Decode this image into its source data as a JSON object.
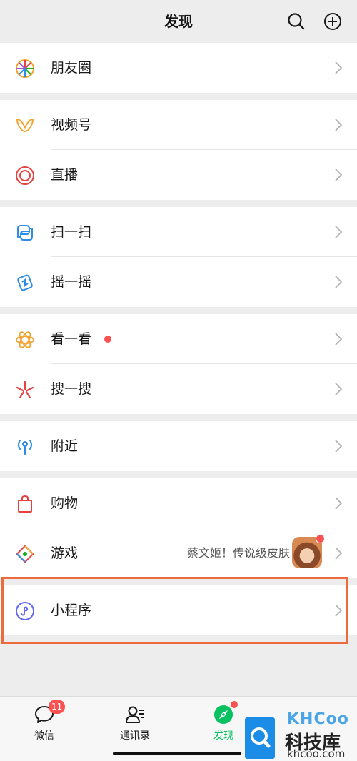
{
  "header": {
    "title": "发现"
  },
  "groups": [
    {
      "items": [
        {
          "label": "朋友圈"
        }
      ]
    },
    {
      "items": [
        {
          "label": "视频号"
        },
        {
          "label": "直播"
        }
      ]
    },
    {
      "items": [
        {
          "label": "扫一扫"
        },
        {
          "label": "摇一摇"
        }
      ]
    },
    {
      "items": [
        {
          "label": "看一看"
        },
        {
          "label": "搜一搜"
        }
      ]
    },
    {
      "items": [
        {
          "label": "附近"
        }
      ]
    },
    {
      "items": [
        {
          "label": "购物"
        },
        {
          "label": "游戏",
          "subtitle": "蔡文姬！传说级皮肤"
        }
      ]
    },
    {
      "items": [
        {
          "label": "小程序"
        }
      ]
    }
  ],
  "tabbar": {
    "tabs": [
      {
        "label": "微信",
        "badge": "11"
      },
      {
        "label": "通讯录"
      },
      {
        "label": "发现"
      }
    ]
  },
  "watermark": {
    "logo": "KHCoo",
    "name": "科技库",
    "site": "khcoo.com"
  },
  "colors": {
    "accent": "#07c160",
    "badge": "#fa5151",
    "highlight": "#ec6b3c",
    "background": "#ededed"
  },
  "icons": {
    "header": [
      "search-icon",
      "add-icon"
    ],
    "rows": [
      "moments-icon",
      "channels-icon",
      "live-icon",
      "scan-icon",
      "shake-icon",
      "top-stories-icon",
      "search-icon",
      "nearby-icon",
      "shopping-icon",
      "games-icon",
      "mini-programs-icon"
    ]
  }
}
